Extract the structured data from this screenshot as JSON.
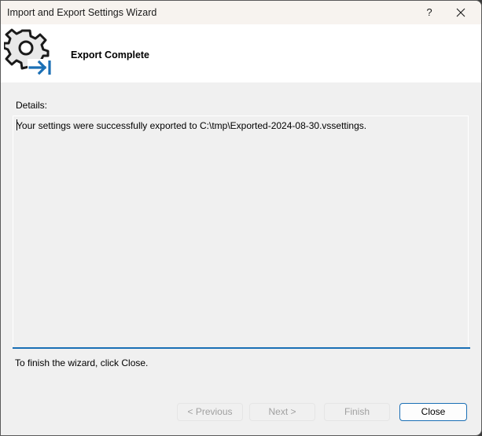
{
  "window": {
    "title": "Import and Export Settings Wizard",
    "help_label": "?",
    "close_icon": "close-icon"
  },
  "header": {
    "icon": "gear-export-icon",
    "title": "Export Complete"
  },
  "details": {
    "label": "Details:",
    "text": "Your settings were successfully exported to C:\\tmp\\Exported-2024-08-30.vssettings."
  },
  "footer": {
    "hint": "To finish the wizard, click Close."
  },
  "buttons": {
    "previous": {
      "label": "< Previous",
      "enabled": false
    },
    "next": {
      "label": "Next >",
      "enabled": false
    },
    "finish": {
      "label": "Finish",
      "enabled": false
    },
    "close": {
      "label": "Close",
      "enabled": true
    }
  },
  "colors": {
    "accent": "#1a6fb5"
  }
}
